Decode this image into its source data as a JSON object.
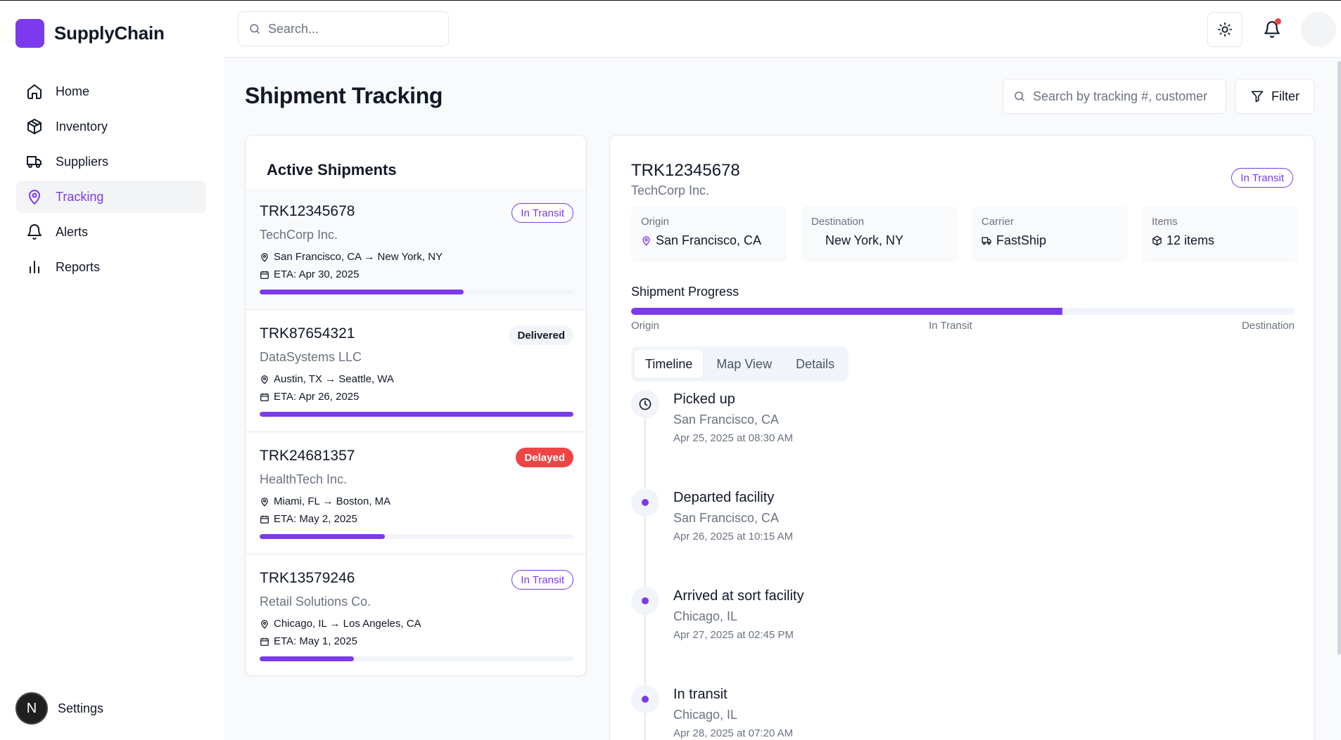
{
  "app": {
    "name": "SupplyChain"
  },
  "nav": {
    "items": [
      {
        "label": "Home",
        "icon": "home-icon"
      },
      {
        "label": "Inventory",
        "icon": "package-icon"
      },
      {
        "label": "Suppliers",
        "icon": "truck-icon"
      },
      {
        "label": "Tracking",
        "icon": "map-pin-icon",
        "active": true
      },
      {
        "label": "Alerts",
        "icon": "bell-icon"
      },
      {
        "label": "Reports",
        "icon": "bar-chart-icon"
      }
    ],
    "settings_label": "Settings",
    "avatar_letter": "N"
  },
  "header": {
    "search_placeholder": "Search..."
  },
  "page": {
    "title": "Shipment Tracking",
    "search_placeholder": "Search by tracking #, customer",
    "filter_label": "Filter"
  },
  "list": {
    "title": "Active Shipments",
    "shipments": [
      {
        "id": "TRK12345678",
        "customer": "TechCorp Inc.",
        "route": "San Francisco, CA → New York, NY",
        "eta": "ETA: Apr 30, 2025",
        "status": "In Transit",
        "progress": 0.65
      },
      {
        "id": "TRK87654321",
        "customer": "DataSystems LLC",
        "route": "Austin, TX → Seattle, WA",
        "eta": "ETA: Apr 26, 2025",
        "status": "Delivered",
        "progress": 1.0
      },
      {
        "id": "TRK24681357",
        "customer": "HealthTech Inc.",
        "route": "Miami, FL → Boston, MA",
        "eta": "ETA: May 2, 2025",
        "status": "Delayed",
        "progress": 0.4
      },
      {
        "id": "TRK13579246",
        "customer": "Retail Solutions Co.",
        "route": "Chicago, IL → Los Angeles, CA",
        "eta": "ETA: May 1, 2025",
        "status": "In Transit",
        "progress": 0.3
      }
    ]
  },
  "detail": {
    "id": "TRK12345678",
    "customer": "TechCorp Inc.",
    "status": "In Transit",
    "info": [
      {
        "label": "Origin",
        "value": "San Francisco, CA",
        "icon": "map-pin-icon"
      },
      {
        "label": "Destination",
        "value": "New York, NY",
        "icon": ""
      },
      {
        "label": "Carrier",
        "value": "FastShip",
        "icon": "truck-icon"
      },
      {
        "label": "Items",
        "value": "12 items",
        "icon": "package-icon"
      }
    ],
    "progress_label": "Shipment Progress",
    "progress": 0.65,
    "progress_steps": [
      "Origin",
      "In Transit",
      "Destination"
    ],
    "tabs": [
      {
        "label": "Timeline",
        "active": true
      },
      {
        "label": "Map View"
      },
      {
        "label": "Details"
      }
    ],
    "timeline": [
      {
        "title": "Picked up",
        "location": "San Francisco, CA",
        "time": "Apr 25, 2025 at 08:30 AM",
        "icon": "clock-icon"
      },
      {
        "title": "Departed facility",
        "location": "San Francisco, CA",
        "time": "Apr 26, 2025 at 10:15 AM",
        "icon": "dot-icon"
      },
      {
        "title": "Arrived at sort facility",
        "location": "Chicago, IL",
        "time": "Apr 27, 2025 at 02:45 PM",
        "icon": "dot-icon"
      },
      {
        "title": "In transit",
        "location": "Chicago, IL",
        "time": "Apr 28, 2025 at 07:20 AM",
        "icon": "dot-icon"
      }
    ]
  },
  "colors": {
    "accent": "#7c3aed",
    "danger": "#ef4444",
    "muted": "#6b7280"
  }
}
